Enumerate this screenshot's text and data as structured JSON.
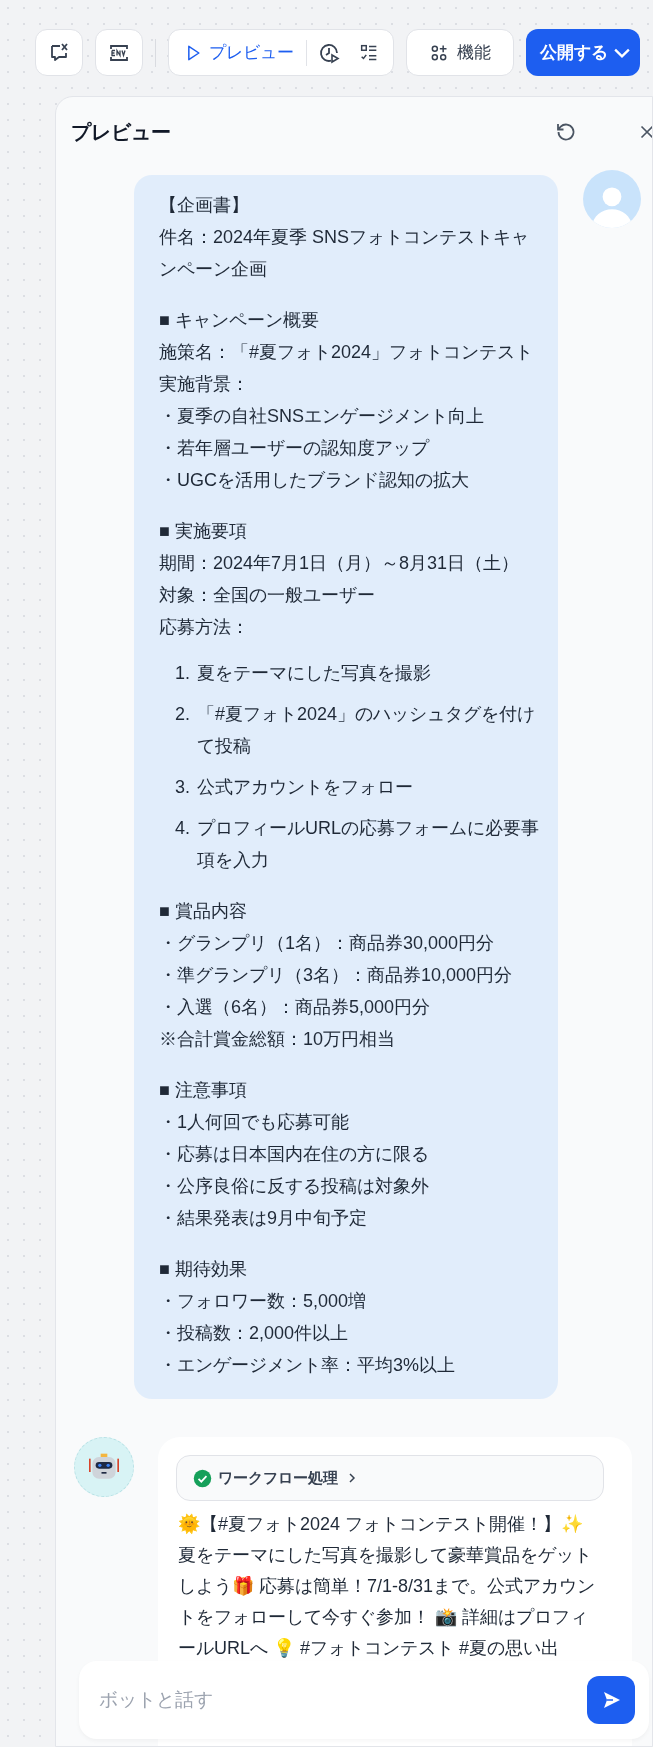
{
  "toolbar": {
    "buttons": [
      {
        "kind": "variable"
      },
      {
        "kind": "env"
      }
    ],
    "preview_group": {
      "label": "プレビュー",
      "selected": true
    },
    "features_button": {
      "label": "機能"
    },
    "publish_button": {
      "label": "公開する"
    }
  },
  "panel": {
    "title": "プレビュー",
    "user_message": {
      "sections": [
        {
          "lines": [
            "【企画書】",
            "件名：2024年夏季 SNSフォトコンテストキャンペーン企画"
          ]
        },
        {
          "lines": [
            "■ キャンペーン概要",
            "施策名：「#夏フォト2024」フォトコンテスト",
            "実施背景：",
            "・夏季の自社SNSエンゲージメント向上",
            "・若年層ユーザーの認知度アップ",
            "・UGCを活用したブランド認知の拡大"
          ]
        },
        {
          "lines": [
            "■ 実施要項",
            "期間：2024年7月1日（月）～8月31日（土）",
            "対象：全国の一般ユーザー",
            "応募方法："
          ],
          "steps": [
            {
              "number": "1.",
              "text": "夏をテーマにした写真を撮影"
            },
            {
              "number": "2.",
              "text": "「#夏フォト2024」のハッシュタグを付けて投稿"
            },
            {
              "number": "3.",
              "text": "公式アカウントをフォロー"
            },
            {
              "number": "4.",
              "text": "プロフィールURLの応募フォームに必要事項を入力"
            }
          ]
        },
        {
          "lines": [
            "■ 賞品内容",
            "・グランプリ（1名）：商品券30,000円分",
            "・準グランプリ（3名）：商品券10,000円分",
            "・入選（6名）：商品券5,000円分",
            "※合計賞金総額：10万円相当"
          ]
        },
        {
          "lines": [
            "■ 注意事項",
            "・1人何回でも応募可能",
            "・応募は日本国内在住の方に限る",
            "・公序良俗に反する投稿は対象外",
            "・結果発表は9月中旬予定"
          ]
        },
        {
          "lines": [
            "■ 期待効果",
            "・フォロワー数：5,000増",
            "・投稿数：2,000件以上",
            "・エンゲージメント率：平均3%以上"
          ]
        }
      ]
    },
    "bot_message": {
      "workflow": {
        "label": "ワークフロー処理",
        "done": true
      },
      "text": "🌞【#夏フォト2024 フォトコンテスト開催！】✨ 夏をテーマにした写真を撮影して豪華賞品をゲットしよう🎁 応募は簡単！7/1-8/31まで。公式アカウントをフォローして今すぐ参加！ 📸 詳細はプロフィールURLへ 💡  #フォトコンテスト #夏の思い出"
    },
    "input": {
      "placeholder": "ボットと話す"
    }
  }
}
